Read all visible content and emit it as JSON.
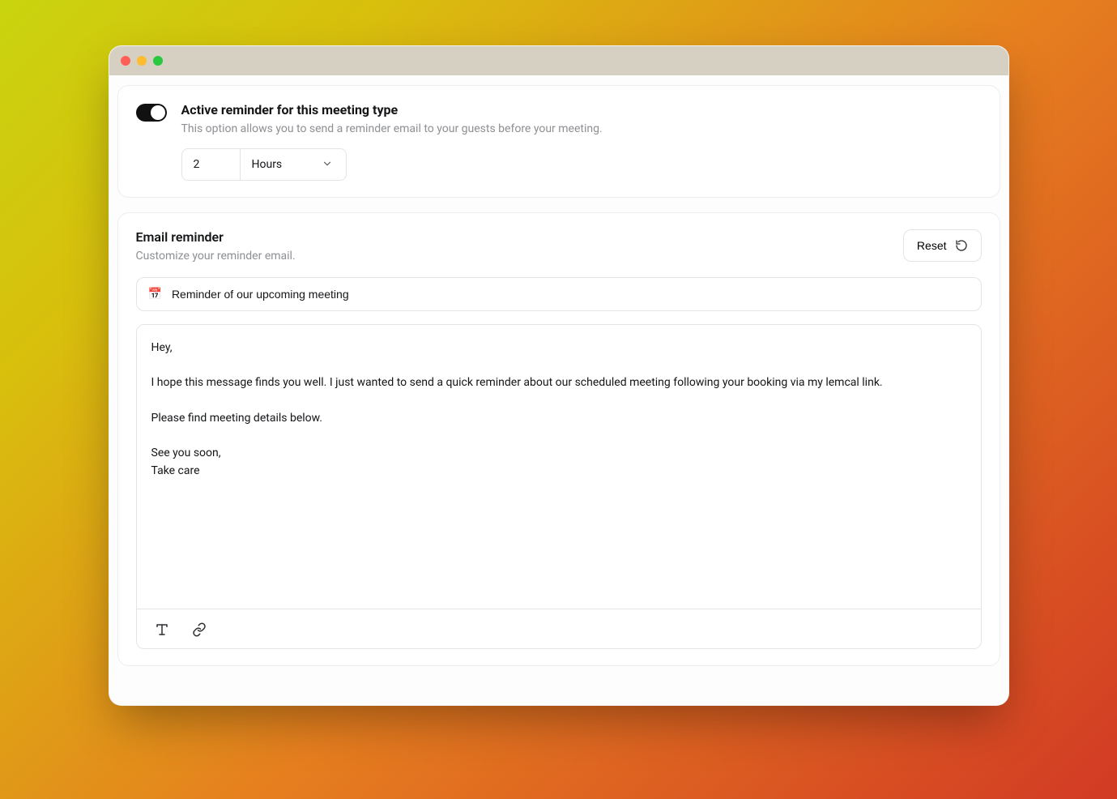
{
  "reminder": {
    "title": "Active reminder for this meeting type",
    "description": "This option allows you to send a reminder email to your guests before your meeting.",
    "value": "2",
    "unit_selected": "Hours"
  },
  "email": {
    "section_title": "Email reminder",
    "section_sub": "Customize your reminder email.",
    "reset_label": "Reset",
    "subject_icon": "📅",
    "subject": "Reminder of our upcoming meeting",
    "body": "Hey,\n\nI hope this message finds you well. I just wanted to send a quick reminder about our scheduled meeting following your booking via my lemcal link.\n\nPlease find meeting details below.\n\nSee you soon,\nTake care"
  }
}
